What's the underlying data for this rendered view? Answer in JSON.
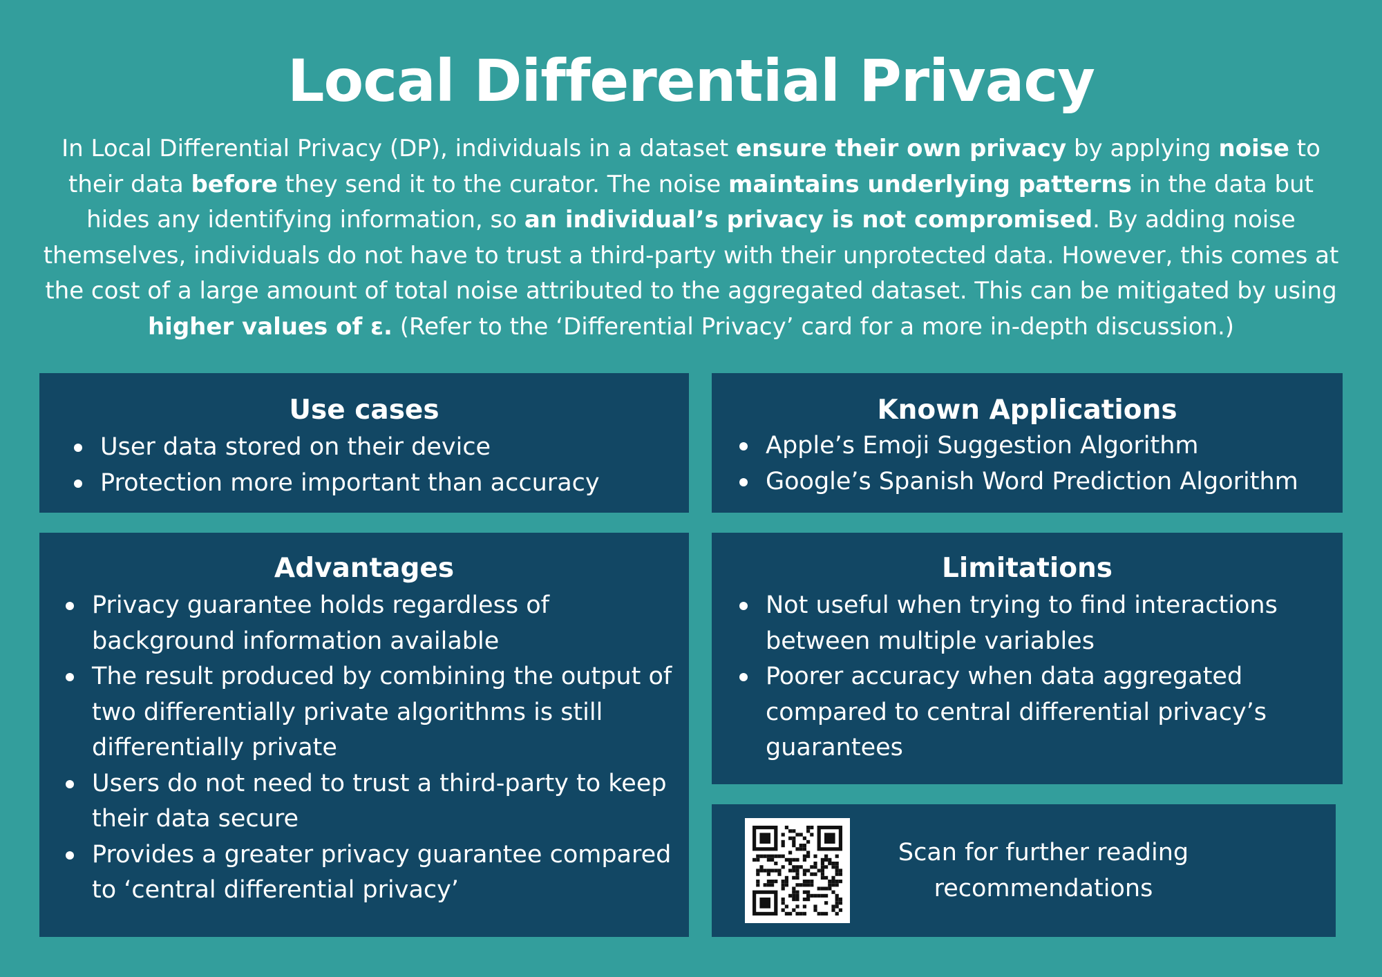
{
  "title": "Local Differential Privacy",
  "intro": [
    {
      "t": "In Local Differential Privacy (DP), individuals in a dataset ",
      "b": false
    },
    {
      "t": "ensure their own privacy",
      "b": true
    },
    {
      "t": " by applying ",
      "b": false
    },
    {
      "t": "noise",
      "b": true
    },
    {
      "t": " to their data ",
      "b": false
    },
    {
      "t": "before",
      "b": true
    },
    {
      "t": " they send it to the curator. The noise ",
      "b": false
    },
    {
      "t": "maintains underlying patterns",
      "b": true
    },
    {
      "t": " in the data but hides any identifying information, so ",
      "b": false
    },
    {
      "t": "an individual’s privacy is not compromised",
      "b": true
    },
    {
      "t": ". By adding noise themselves, individuals do not have to trust a third-party with their unprotected data. However, this comes at the cost of a large amount of total noise attributed to the aggregated dataset. This can be mitigated by using ",
      "b": false
    },
    {
      "t": "higher values of ε.",
      "b": true
    },
    {
      "t": " (Refer to the ‘Differential Privacy’ card for a more in-depth discussion.)",
      "b": false
    }
  ],
  "use_cases": {
    "heading": "Use cases",
    "items": [
      "User data stored on their device",
      "Protection more important than accuracy"
    ]
  },
  "known_applications": {
    "heading": "Known Applications",
    "items": [
      "Apple’s Emoji Suggestion Algorithm",
      "Google’s Spanish Word Prediction Algorithm"
    ]
  },
  "advantages": {
    "heading": "Advantages",
    "items": [
      "Privacy guarantee holds regardless of background information available",
      "The result produced by combining the output of two differentially private algorithms is still differentially private",
      "Users do not need to trust a third-party to keep their data secure",
      "Provides a greater privacy guarantee compared to ‘central differential privacy’"
    ]
  },
  "limitations": {
    "heading": "Limitations",
    "items": [
      "Not useful when trying to find interactions between multiple variables",
      "Poorer accuracy when data aggregated compared to central differential privacy’s guarantees"
    ]
  },
  "qr": {
    "icon": "qr-code-icon",
    "text": "Scan for further reading recommendations"
  },
  "colors": {
    "background": "#339e9c",
    "card": "#124764",
    "text": "#ffffff"
  }
}
